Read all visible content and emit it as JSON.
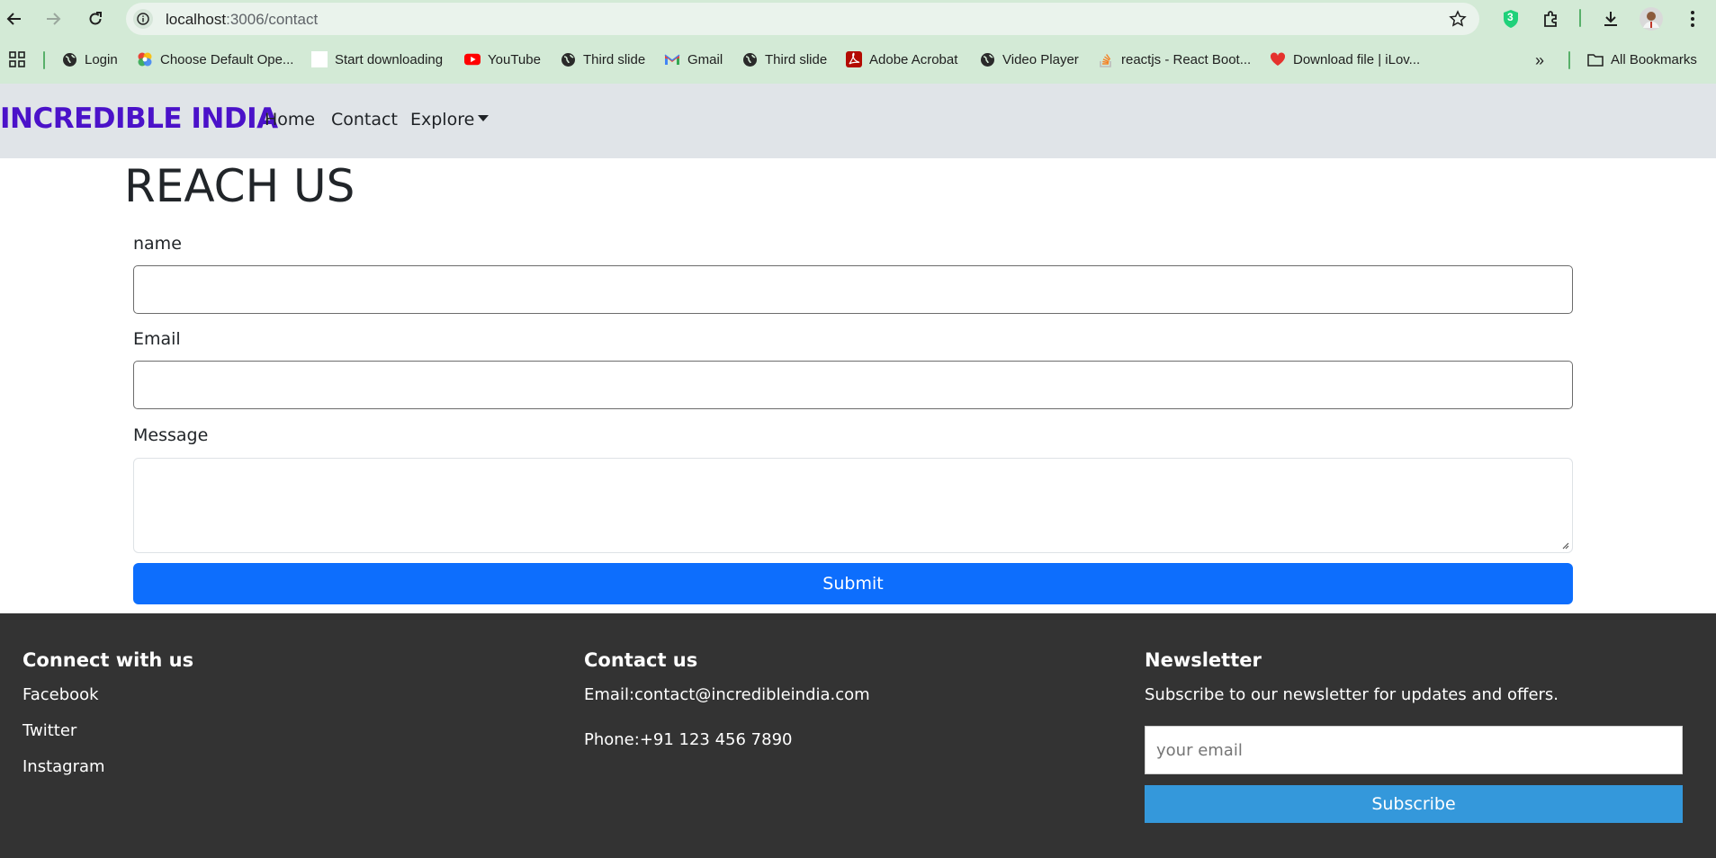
{
  "browser": {
    "url_host": "localhost",
    "url_path": ":3006/contact",
    "profile_avatar": "profile-avatar",
    "extension_badge": "3",
    "bookmarks": [
      {
        "label": "Login",
        "icon": "globe-icon"
      },
      {
        "label": "Choose Default Ope...",
        "icon": "multicolor-app-icon"
      },
      {
        "label": "Start downloading",
        "icon": "blank-page-icon"
      },
      {
        "label": "YouTube",
        "icon": "youtube-icon"
      },
      {
        "label": "Third slide",
        "icon": "globe-icon"
      },
      {
        "label": "Gmail",
        "icon": "gmail-icon"
      },
      {
        "label": "Third slide",
        "icon": "globe-icon"
      },
      {
        "label": "Adobe Acrobat",
        "icon": "acrobat-icon"
      },
      {
        "label": "Video Player",
        "icon": "globe-icon"
      },
      {
        "label": "reactjs - React Boot...",
        "icon": "stackoverflow-icon"
      },
      {
        "label": "Download file | iLov...",
        "icon": "heart-icon"
      }
    ],
    "all_bookmarks_label": "All Bookmarks"
  },
  "navbar": {
    "brand": "INCREDIBLE INDIA",
    "links": [
      "Home",
      "Contact",
      "Explore"
    ],
    "background": "#e0e4e8",
    "brand_color": "#4b12c9"
  },
  "contact_form": {
    "title": "REACH US",
    "name_label": "name",
    "email_label": "Email",
    "message_label": "Message",
    "name_value": "",
    "email_value": "",
    "message_value": "",
    "submit_label": "Submit",
    "submit_color": "#0d6efd"
  },
  "footer": {
    "background": "#333333",
    "connect": {
      "heading": "Connect with us",
      "links": [
        "Facebook",
        "Twitter",
        "Instagram"
      ]
    },
    "contact": {
      "heading": "Contact us",
      "email": "Email:contact@incredibleindia.com",
      "phone": "Phone:+91 123 456 7890"
    },
    "newsletter": {
      "heading": "Newsletter",
      "text": "Subscribe to our newsletter for updates and offers.",
      "placeholder": "your email",
      "button": "Subscribe",
      "button_color": "#3498db"
    }
  }
}
